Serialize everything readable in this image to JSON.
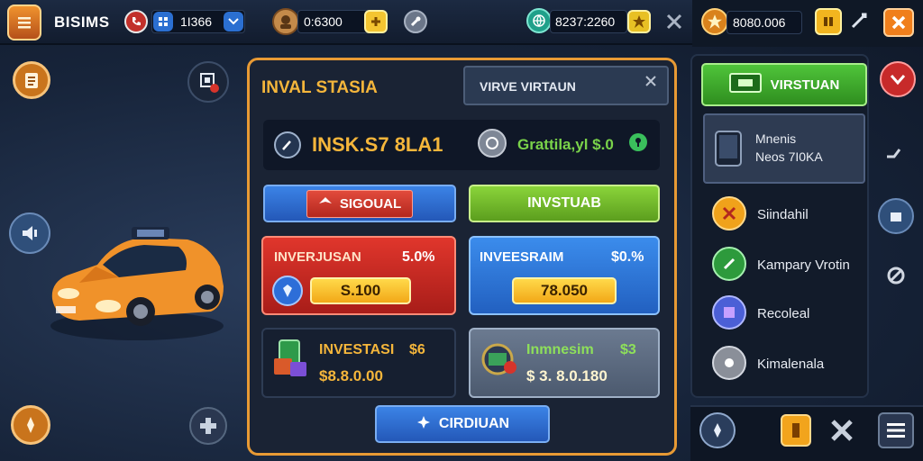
{
  "header": {
    "brand": "BISIMS",
    "stat_1": "1I366",
    "coins": "0:6300",
    "gems": "8237:2260",
    "trophy_balance": "8080.006"
  },
  "left_icons": [
    "clipboard-icon",
    "map-icon",
    "speaker-icon",
    "compass-icon",
    "dpad-icon"
  ],
  "panel": {
    "title": "INVAL STASIA",
    "tab": "VIRVE VIRTAUN",
    "info_left": "INSK.S7 8LA1",
    "info_right": "Grattila,yl $.0",
    "btn_left": "SIGOUAL",
    "btn_right": "INVSTUAB",
    "cards": [
      {
        "title": "INVERJUSAN",
        "pct": "5.0%",
        "value": "S.100"
      },
      {
        "title": "INVEESRAIM",
        "pct": "$0.%",
        "value": "78.050"
      },
      {
        "title": "INVESTASI",
        "pct": "$6",
        "value": "$8.8.0.00"
      },
      {
        "title": "Inmnesim",
        "pct": "$3",
        "value": "$ 3. 8.0.180"
      }
    ],
    "bottom_btn": "CIRDIUAN"
  },
  "right_panel": {
    "header_btn": "VIRSTUAN",
    "highlight_line1": "Mnenis",
    "highlight_line2": "Neos 7I0KA",
    "items": [
      {
        "label": "Siindahil",
        "color": "#f0a21b"
      },
      {
        "label": "Kampary Vrotin",
        "color": "#2d9a3c"
      },
      {
        "label": "Recoleal",
        "color": "#4b5fd6"
      },
      {
        "label": "Kimalenala",
        "color": "#8a8f99"
      }
    ]
  },
  "colors": {
    "accent": "#e89a34",
    "red": "#d6342b",
    "green": "#7bc62d",
    "blue": "#2f7fe0"
  }
}
